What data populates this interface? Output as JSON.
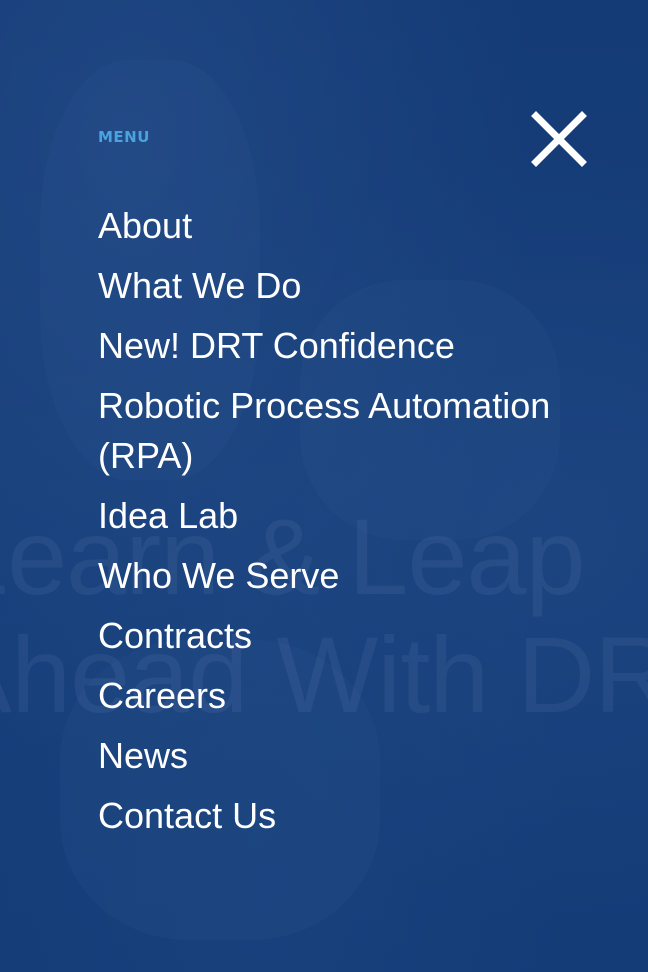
{
  "menu": {
    "label": "MENU",
    "close_icon": "close-icon",
    "items": [
      {
        "label": "About"
      },
      {
        "label": "What We Do"
      },
      {
        "label": "New! DRT Confidence"
      },
      {
        "label": "Robotic Process Automation (RPA)"
      },
      {
        "label": "Idea Lab"
      },
      {
        "label": "Who We Serve"
      },
      {
        "label": "Contracts"
      },
      {
        "label": "Careers"
      },
      {
        "label": "News"
      },
      {
        "label": "Contact Us"
      }
    ]
  },
  "background": {
    "line1": "Learn & Leap",
    "line2": "Ahead With DRT"
  },
  "colors": {
    "overlay": "#173f7a",
    "menu_label": "#4aa3df",
    "menu_text": "#ffffff"
  }
}
